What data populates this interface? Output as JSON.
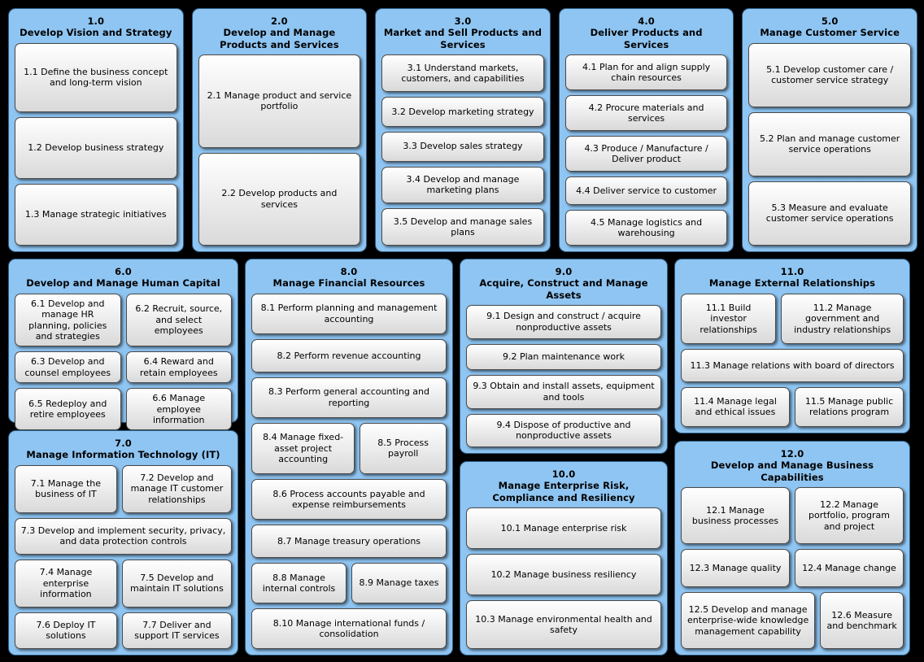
{
  "colors": {
    "panel_blue": "#8fc5f2",
    "panel_border": "#2f5f86",
    "box_top": "#ffffff",
    "box_bottom": "#d9d9d9",
    "box_border": "#4a4a4a",
    "background": "#000000",
    "text": "#000000"
  },
  "operating_categories": [
    {
      "number": "1.0",
      "title": "Develop Vision and Strategy",
      "processes": [
        {
          "id": "1.1",
          "label": "1.1 Define the business concept and long-term vision"
        },
        {
          "id": "1.2",
          "label": "1.2 Develop business strategy"
        },
        {
          "id": "1.3",
          "label": "1.3 Manage strategic initiatives"
        }
      ]
    },
    {
      "number": "2.0",
      "title": "Develop and Manage Products and Services",
      "processes": [
        {
          "id": "2.1",
          "label": "2.1 Manage product and service portfolio"
        },
        {
          "id": "2.2",
          "label": "2.2 Develop products and services"
        }
      ]
    },
    {
      "number": "3.0",
      "title": "Market and Sell Products and Services",
      "processes": [
        {
          "id": "3.1",
          "label": "3.1 Understand markets, customers, and capabilities"
        },
        {
          "id": "3.2",
          "label": "3.2 Develop marketing strategy"
        },
        {
          "id": "3.3",
          "label": "3.3 Develop sales strategy"
        },
        {
          "id": "3.4",
          "label": "3.4 Develop and manage marketing plans"
        },
        {
          "id": "3.5",
          "label": "3.5 Develop and manage sales plans"
        }
      ]
    },
    {
      "number": "4.0",
      "title": "Deliver Products and Services",
      "processes": [
        {
          "id": "4.1",
          "label": "4.1 Plan for and align supply chain resources"
        },
        {
          "id": "4.2",
          "label": "4.2 Procure materials and services"
        },
        {
          "id": "4.3",
          "label": "4.3 Produce / Manufacture / Deliver product"
        },
        {
          "id": "4.4",
          "label": "4.4 Deliver service to customer"
        },
        {
          "id": "4.5",
          "label": "4.5 Manage logistics and warehousing"
        }
      ]
    },
    {
      "number": "5.0",
      "title": "Manage Customer Service",
      "processes": [
        {
          "id": "5.1",
          "label": "5.1 Develop customer care / customer service strategy"
        },
        {
          "id": "5.2",
          "label": "5.2 Plan and manage customer service operations"
        },
        {
          "id": "5.3",
          "label": "5.3 Measure and evaluate customer service operations"
        }
      ]
    }
  ],
  "management_categories": {
    "human_capital": {
      "number": "6.0",
      "title": "Develop and Manage Human Capital",
      "processes": [
        {
          "id": "6.1",
          "label": "6.1 Develop and manage HR planning, policies and strategies"
        },
        {
          "id": "6.2",
          "label": "6.2 Recruit, source, and select employees"
        },
        {
          "id": "6.3",
          "label": "6.3 Develop and counsel employees"
        },
        {
          "id": "6.4",
          "label": "6.4 Reward and retain employees"
        },
        {
          "id": "6.5",
          "label": "6.5 Redeploy and retire employees"
        },
        {
          "id": "6.6",
          "label": "6.6 Manage employee information"
        }
      ]
    },
    "information_technology": {
      "number": "7.0",
      "title": "Manage Information Technology (IT)",
      "processes": [
        {
          "id": "7.1",
          "label": "7.1 Manage the business of IT"
        },
        {
          "id": "7.2",
          "label": "7.2 Develop and manage IT customer relationships"
        },
        {
          "id": "7.3",
          "label": "7.3 Develop and implement security, privacy, and data protection controls"
        },
        {
          "id": "7.4",
          "label": "7.4 Manage enterprise information"
        },
        {
          "id": "7.5",
          "label": "7.5 Develop and maintain IT solutions"
        },
        {
          "id": "7.6",
          "label": "7.6 Deploy IT solutions"
        },
        {
          "id": "7.7",
          "label": "7.7 Deliver and support IT services"
        }
      ]
    },
    "financial_resources": {
      "number": "8.0",
      "title": "Manage Financial Resources",
      "processes": [
        {
          "id": "8.1",
          "label": "8.1 Perform planning and management accounting"
        },
        {
          "id": "8.2",
          "label": "8.2 Perform revenue accounting"
        },
        {
          "id": "8.3",
          "label": "8.3 Perform general accounting and reporting"
        },
        {
          "id": "8.4",
          "label": "8.4 Manage fixed-asset project accounting"
        },
        {
          "id": "8.5",
          "label": "8.5 Process payroll"
        },
        {
          "id": "8.6",
          "label": "8.6 Process accounts payable and expense reimbursements"
        },
        {
          "id": "8.7",
          "label": "8.7 Manage treasury operations"
        },
        {
          "id": "8.8",
          "label": "8.8 Manage internal controls"
        },
        {
          "id": "8.9",
          "label": "8.9 Manage taxes"
        },
        {
          "id": "8.10",
          "label": "8.10 Manage international funds / consolidation"
        }
      ]
    },
    "assets": {
      "number": "9.0",
      "title": "Acquire, Construct and Manage Assets",
      "processes": [
        {
          "id": "9.1",
          "label": "9.1 Design and construct / acquire nonproductive assets"
        },
        {
          "id": "9.2",
          "label": "9.2 Plan maintenance work"
        },
        {
          "id": "9.3",
          "label": "9.3 Obtain and install assets, equipment and tools"
        },
        {
          "id": "9.4",
          "label": "9.4 Dispose of productive and nonproductive assets"
        }
      ]
    },
    "risk": {
      "number": "10.0",
      "title": "Manage Enterprise Risk, Compliance and Resiliency",
      "processes": [
        {
          "id": "10.1",
          "label": "10.1 Manage enterprise risk"
        },
        {
          "id": "10.2",
          "label": "10.2 Manage business resiliency"
        },
        {
          "id": "10.3",
          "label": "10.3 Manage environmental health and safety"
        }
      ]
    },
    "external_relationships": {
      "number": "11.0",
      "title": "Manage External Relationships",
      "processes": [
        {
          "id": "11.1",
          "label": "11.1 Build investor relationships"
        },
        {
          "id": "11.2",
          "label": "11.2 Manage government and industry relationships"
        },
        {
          "id": "11.3",
          "label": "11.3 Manage relations with board of directors"
        },
        {
          "id": "11.4",
          "label": "11.4 Manage legal and ethical issues"
        },
        {
          "id": "11.5",
          "label": "11.5 Manage public relations program"
        }
      ]
    },
    "business_capabilities": {
      "number": "12.0",
      "title": "Develop and Manage Business Capabilities",
      "processes": [
        {
          "id": "12.1",
          "label": "12.1 Manage business processes"
        },
        {
          "id": "12.2",
          "label": "12.2 Manage portfolio, program and project"
        },
        {
          "id": "12.3",
          "label": "12.3 Manage quality"
        },
        {
          "id": "12.4",
          "label": "12.4 Manage change"
        },
        {
          "id": "12.5",
          "label": "12.5 Develop and manage enterprise-wide knowledge management capability"
        },
        {
          "id": "12.6",
          "label": "12.6 Measure and benchmark"
        }
      ]
    }
  }
}
